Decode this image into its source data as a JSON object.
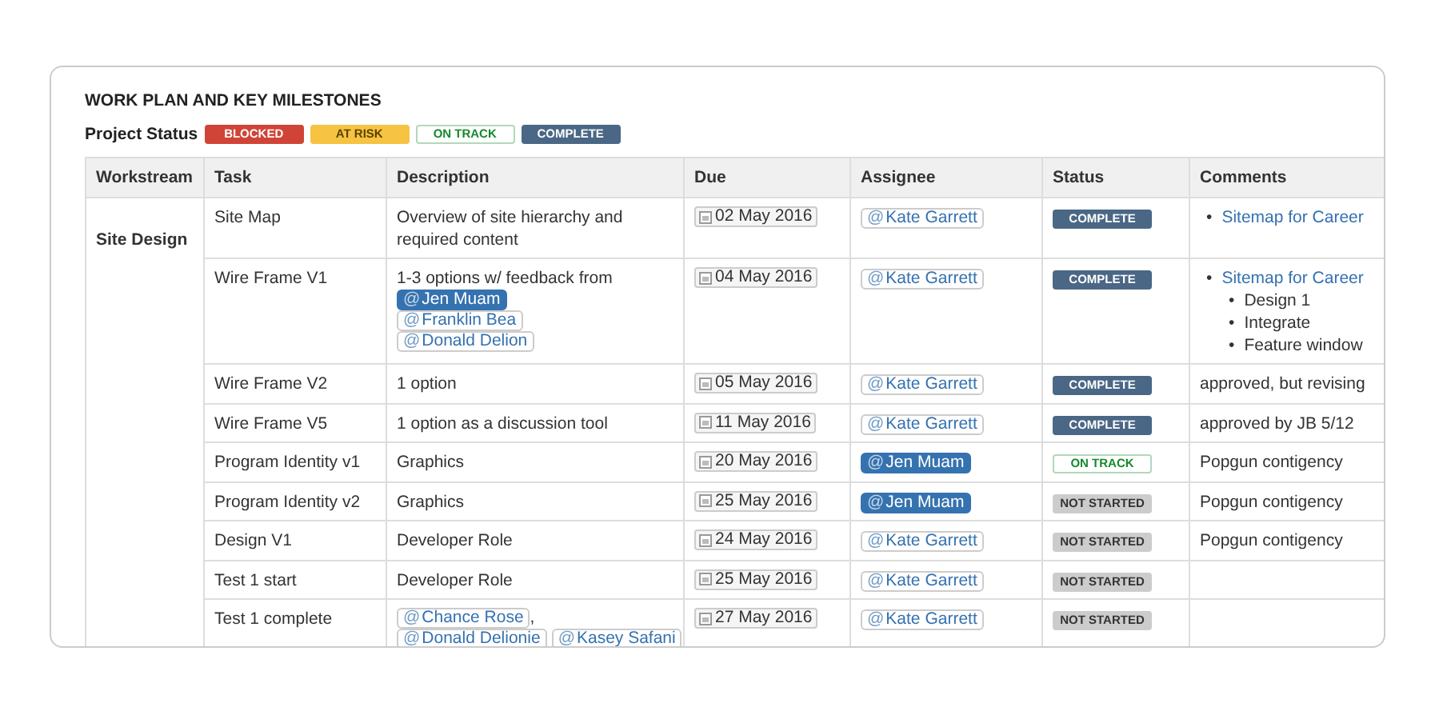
{
  "title": "WORK PLAN AND KEY MILESTONES",
  "project_status": {
    "label": "Project Status",
    "legend": [
      {
        "text": "BLOCKED",
        "kind": "blocked"
      },
      {
        "text": "AT RISK",
        "kind": "risk"
      },
      {
        "text": "ON TRACK",
        "kind": "track"
      },
      {
        "text": "COMPLETE",
        "kind": "complete"
      }
    ]
  },
  "table": {
    "columns": [
      "Workstream",
      "Task",
      "Description",
      "Due",
      "Assignee",
      "Status",
      "Comments"
    ],
    "workstream": "Site Design",
    "rows": [
      {
        "task": "Site Map",
        "description": [
          {
            "kind": "text",
            "text": "Overview of site hierarchy and required content"
          }
        ],
        "due": "02 May 2016",
        "assignee": {
          "at": "@",
          "name": "Kate Garrett",
          "kind": "other"
        },
        "status": {
          "text": "COMPLETE",
          "kind": "complete"
        },
        "comments": [
          {
            "kind": "link",
            "bullet": "•",
            "text": "Sitemap for Career"
          }
        ]
      },
      {
        "task": "Wire Frame V1",
        "description": [
          {
            "kind": "text",
            "text": "1-3 options w/ feedback from"
          },
          {
            "kind": "mention",
            "mention": {
              "at": "@",
              "name": "Jen Muam",
              "kind": "self"
            }
          },
          {
            "kind": "mention",
            "mention": {
              "at": "@",
              "name": "Franklin Bea",
              "kind": "other"
            }
          },
          {
            "kind": "mention",
            "mention": {
              "at": "@",
              "name": "Donald Delion",
              "kind": "other"
            }
          }
        ],
        "due": "04 May 2016",
        "assignee": {
          "at": "@",
          "name": "Kate Garrett",
          "kind": "other"
        },
        "status": {
          "text": "COMPLETE",
          "kind": "complete"
        },
        "comments": [
          {
            "kind": "link",
            "bullet": "•",
            "text": "Sitemap for Career",
            "children": [
              {
                "bullet": "•",
                "text": "Design 1"
              },
              {
                "bullet": "•",
                "text": "Integrate"
              },
              {
                "bullet": "•",
                "text": "Feature window"
              }
            ]
          }
        ]
      },
      {
        "task": "Wire Frame V2",
        "description": [
          {
            "kind": "text",
            "text": "1 option"
          }
        ],
        "due": "05 May 2016",
        "assignee": {
          "at": "@",
          "name": "Kate Garrett",
          "kind": "other"
        },
        "status": {
          "text": "COMPLETE",
          "kind": "complete"
        },
        "comments": [
          {
            "kind": "text",
            "text": "approved, but revising"
          }
        ]
      },
      {
        "task": "Wire Frame V5",
        "description": [
          {
            "kind": "text",
            "text": "1 option as a discussion tool"
          }
        ],
        "due": "11 May 2016",
        "assignee": {
          "at": "@",
          "name": "Kate Garrett",
          "kind": "other"
        },
        "status": {
          "text": "COMPLETE",
          "kind": "complete"
        },
        "comments": [
          {
            "kind": "text",
            "text": "approved by JB 5/12"
          }
        ]
      },
      {
        "task": "Program Identity v1",
        "description": [
          {
            "kind": "text",
            "text": "Graphics"
          }
        ],
        "due": "20 May 2016",
        "assignee": {
          "at": "@",
          "name": "Jen Muam",
          "kind": "self"
        },
        "status": {
          "text": "ON TRACK",
          "kind": "track"
        },
        "comments": [
          {
            "kind": "text",
            "text": "Popgun contigency"
          }
        ]
      },
      {
        "task": "Program Identity v2",
        "description": [
          {
            "kind": "text",
            "text": "Graphics"
          }
        ],
        "due": "25 May 2016",
        "assignee": {
          "at": "@",
          "name": "Jen Muam",
          "kind": "self"
        },
        "status": {
          "text": "NOT STARTED",
          "kind": "not_started"
        },
        "comments": [
          {
            "kind": "text",
            "text": "Popgun contigency"
          }
        ]
      },
      {
        "task": "Design V1",
        "description": [
          {
            "kind": "text",
            "text": "Developer Role"
          }
        ],
        "due": "24 May 2016",
        "assignee": {
          "at": "@",
          "name": "Kate Garrett",
          "kind": "other"
        },
        "status": {
          "text": "NOT STARTED",
          "kind": "not_started"
        },
        "comments": [
          {
            "kind": "text",
            "text": "Popgun contigency"
          }
        ]
      },
      {
        "task": "Test 1 start",
        "description": [
          {
            "kind": "text",
            "text": "Developer Role"
          }
        ],
        "due": "25 May 2016",
        "assignee": {
          "at": "@",
          "name": "Kate Garrett",
          "kind": "other"
        },
        "status": {
          "text": "NOT STARTED",
          "kind": "not_started"
        },
        "comments": []
      },
      {
        "task": "Test 1 complete",
        "description": [
          {
            "kind": "mention",
            "mention": {
              "at": "@",
              "name": "Chance Rose",
              "kind": "other"
            },
            "suffix": ","
          },
          {
            "kind": "mention",
            "mention": {
              "at": "@",
              "name": "Donald Delionie",
              "kind": "other"
            }
          },
          {
            "kind": "mention",
            "mention": {
              "at": "@",
              "name": "Kasey Safani",
              "kind": "other"
            }
          }
        ],
        "due": "27 May 2016",
        "assignee": {
          "at": "@",
          "name": "Kate Garrett",
          "kind": "other"
        },
        "status": {
          "text": "NOT STARTED",
          "kind": "not_started"
        },
        "comments": []
      }
    ]
  }
}
